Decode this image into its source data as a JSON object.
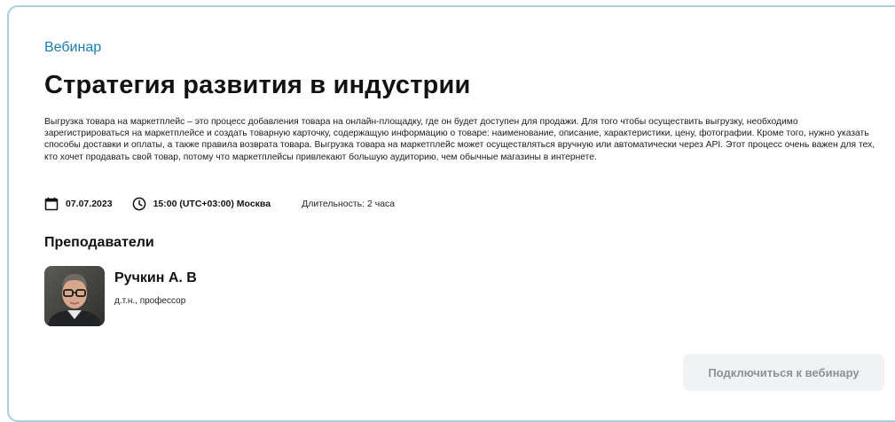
{
  "event": {
    "type_label": "Вебинар",
    "title": "Стратегия развития в индустрии",
    "description": "Выгрузка товара на маркетплейс – это процесс добавления товара на онлайн-площадку, где он будет доступен для продажи. Для того чтобы осуществить выгрузку, необходимо зарегистрироваться на маркетплейсе и создать товарную карточку, содержащую информацию о товаре: наименование, описание, характеристики, цену, фотографии. Кроме того, нужно указать способы доставки и оплаты, а также правила возврата товара. Выгрузка товара на маркетплейс может осуществляться вручную или автоматически через API. Этот процесс очень важен для тех, кто хочет продавать свой товар, потому что маркетплейсы привлекают большую аудиторию, чем обычные магазины в интернете.",
    "date": "07.07.2023",
    "time": "15:00 (UTC+03:00) Москва",
    "duration": "Длительность: 2 часа",
    "icons": {
      "date": "calendar-icon",
      "time": "clock-icon"
    }
  },
  "teachers": {
    "section_title": "Преподаватели",
    "items": [
      {
        "name": "Ручкин А. В",
        "degree": "д.т.н., профессор"
      }
    ]
  },
  "actions": {
    "join_label": "Подключиться к вебинару"
  },
  "colors": {
    "accent": "#1a7fae",
    "card_border": "#a9cfe2",
    "button_bg": "#f1f2f3",
    "button_text": "#8d9196"
  }
}
